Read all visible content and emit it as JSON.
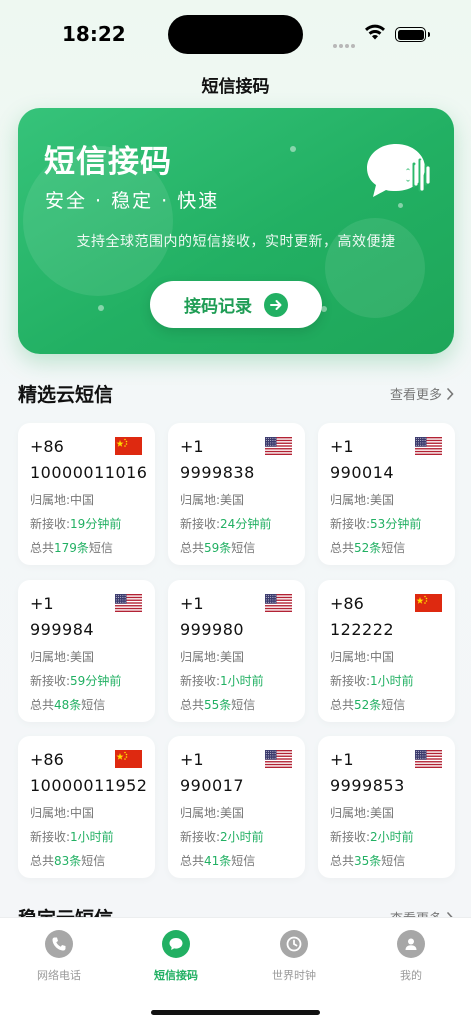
{
  "status_bar": {
    "time": "18:22"
  },
  "page_title": "短信接码",
  "hero": {
    "title": "短信接码",
    "slogan": "安全 · 稳定 · 快速",
    "description": "支持全球范围内的短信接收，实时更新，高效便捷",
    "button_label": "接码记录"
  },
  "featured": {
    "title": "精选云短信",
    "more_label": "查看更多",
    "cards": [
      {
        "code": "+86",
        "flag": "cn",
        "number": "10000011016",
        "region": "归属地:中国",
        "recent_prefix": "新接收:",
        "recent": "19分钟前",
        "total_prefix": "总共",
        "total": "179条",
        "total_suffix": "短信"
      },
      {
        "code": "+1",
        "flag": "us",
        "number": "9999838",
        "region": "归属地:美国",
        "recent_prefix": "新接收:",
        "recent": "24分钟前",
        "total_prefix": "总共",
        "total": "59条",
        "total_suffix": "短信"
      },
      {
        "code": "+1",
        "flag": "us",
        "number": "990014",
        "region": "归属地:美国",
        "recent_prefix": "新接收:",
        "recent": "53分钟前",
        "total_prefix": "总共",
        "total": "52条",
        "total_suffix": "短信"
      },
      {
        "code": "+1",
        "flag": "us",
        "number": "999984",
        "region": "归属地:美国",
        "recent_prefix": "新接收:",
        "recent": "59分钟前",
        "total_prefix": "总共",
        "total": "48条",
        "total_suffix": "短信"
      },
      {
        "code": "+1",
        "flag": "us",
        "number": "999980",
        "region": "归属地:美国",
        "recent_prefix": "新接收:",
        "recent": "1小时前",
        "total_prefix": "总共",
        "total": "55条",
        "total_suffix": "短信"
      },
      {
        "code": "+86",
        "flag": "cn",
        "number": "122222",
        "region": "归属地:中国",
        "recent_prefix": "新接收:",
        "recent": "1小时前",
        "total_prefix": "总共",
        "total": "52条",
        "total_suffix": "短信"
      },
      {
        "code": "+86",
        "flag": "cn",
        "number": "10000011952",
        "region": "归属地:中国",
        "recent_prefix": "新接收:",
        "recent": "1小时前",
        "total_prefix": "总共",
        "total": "83条",
        "total_suffix": "短信"
      },
      {
        "code": "+1",
        "flag": "us",
        "number": "990017",
        "region": "归属地:美国",
        "recent_prefix": "新接收:",
        "recent": "2小时前",
        "total_prefix": "总共",
        "total": "41条",
        "total_suffix": "短信"
      },
      {
        "code": "+1",
        "flag": "us",
        "number": "9999853",
        "region": "归属地:美国",
        "recent_prefix": "新接收:",
        "recent": "2小时前",
        "total_prefix": "总共",
        "total": "35条",
        "total_suffix": "短信"
      }
    ]
  },
  "stable": {
    "title": "稳定云短信",
    "more_label": "查看更多"
  },
  "tabbar": {
    "items": [
      {
        "label": "网络电话",
        "icon": "phone-icon",
        "active": false
      },
      {
        "label": "短信接码",
        "icon": "message-icon",
        "active": true
      },
      {
        "label": "世界时钟",
        "icon": "clock-icon",
        "active": false
      },
      {
        "label": "我的",
        "icon": "user-icon",
        "active": false
      }
    ]
  },
  "colors": {
    "accent": "#22b063",
    "inactive": "#a7a7a7"
  }
}
